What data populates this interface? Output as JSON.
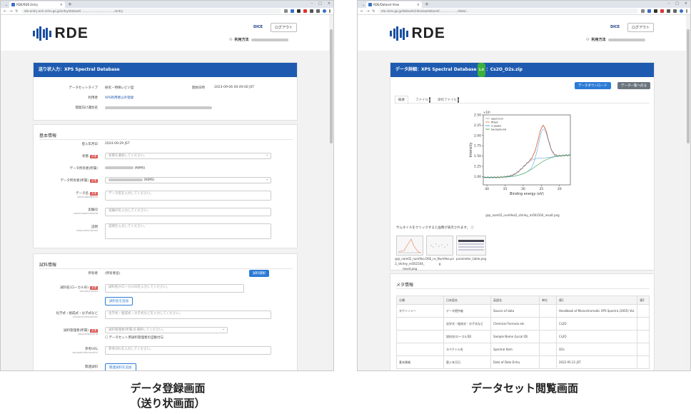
{
  "left": {
    "tab_title": "RDE/RDE Entry",
    "url": "rde-entry-arm.nims.go.jp/entry/dataset/...................................../entry",
    "logo_text": "RDE",
    "dice": "DICE",
    "logout": "ログアウト",
    "user_label": "利用方法",
    "band_title": "送り状入力：XPS Spectral Database",
    "info": {
      "dataset_type_label": "データセットタイプ",
      "dataset_type_value": "研究・特徴レビジ型",
      "registered_label": "開始日時",
      "registered_value": "2023-09-06 00:49:00 JST",
      "template_label": "利用者",
      "template_value": "XPS利用者以外登録",
      "dataset_id_label": "開発向け識別名"
    },
    "basic": {
      "title": "基本情報",
      "date_label": "登入年月日",
      "date_value": "2024-09-29 JST",
      "status_label": "状態",
      "status_placeholder": "状態を選択してください。",
      "owner_label": "データ所有者(所属)",
      "owner_suffix": "(NIMS)",
      "owner2_label": "データ所有者(所属)",
      "owner2_suffix": "(NIMS)",
      "dataname_label": "データ名",
      "dataname_sub": "basic/dataName",
      "dataname_placeholder": "データ名を入力してください。",
      "exp_label": "実験ID",
      "exp_sub": "basic/experimentId",
      "exp_placeholder": "実験IDを入力してください。",
      "desc_label": "説明",
      "desc_sub": "basic/description",
      "desc_placeholder": "説明を入力してください。",
      "required": "必須"
    },
    "sample": {
      "title": "試料情報",
      "owner_label": "所有者",
      "owner_value": "(所有者名)",
      "select_btn": "試料選択",
      "name_label": "試料名(ローカルID)",
      "name_sub": "sample/names",
      "name_placeholder": "試料名かローカルIDを入力してください。",
      "add_btn": "試料名を追加",
      "comp_label": "化学式・組成式・分子式など",
      "comp_sub": "sample/composition",
      "comp_placeholder": "化学式・組成式・分子式などを入力してください。",
      "manager_label": "試料管理者(所属)",
      "manager_sub": "sample/ownerId",
      "manager_placeholder": "試料管理者(所属)を選択してください。",
      "checkbox_text": "データセット用試料管理者の自動付与",
      "ref_label": "参考URL",
      "ref_sub": "sample/referenceUrl",
      "ref_placeholder": "参考URLを入力してください。",
      "tag_label": "関連試料",
      "tag_btn": "関連試料を追加"
    }
  },
  "right": {
    "tab_title": "RDE/Dataset View",
    "url": "rde.nims.go.jp/datasets/rdeview/dataset/..................../data/...",
    "band_prefix": "データ詳細：XPS Spectral Database",
    "band_version": "1.0",
    "band_suffix": "：Cs2O_O2s.zip",
    "download_btn": "データダウンロード",
    "list_btn": "データ一覧へ戻る",
    "tabs": [
      {
        "label": "概要",
        "badge": ""
      },
      {
        "label": "ファイル",
        "badge": "9"
      },
      {
        "label": "添付ファイル",
        "badge": "0"
      }
    ],
    "chart_caption": "gsp_nam02_num9ea2_shirley_mOS1504_result.png",
    "thumb_note": "サムネイルをクリックすると画像が表示されます。",
    "thumbs": [
      {
        "name": "gsp_nam02_num9ea2_shirley_mOS1504_result.png"
      },
      {
        "name": "DSE_ns_Num9ea.png"
      },
      {
        "name": "parameter_table.png"
      }
    ],
    "meta_title": "メタ情報",
    "meta_headers": [
      "分類",
      "日本語名",
      "英語名",
      "単位",
      "値1",
      "値2"
    ],
    "meta_rows": [
      [
        "タクソノミー",
        "データ提供者",
        "Source of data",
        "",
        "Handbook of Monochromatic XPS Spectra (2005) Vol.",
        ""
      ],
      [
        "",
        "化学式・組成式・分子式など",
        "Chemical Formula etc.",
        "",
        "Cs2O",
        ""
      ],
      [
        "",
        "試料名(ローカルID)",
        "Sample Name (Local ID)",
        "",
        "Cs2O",
        ""
      ],
      [
        "",
        "スペクトル名",
        "Spectral Item",
        "",
        "O2s",
        ""
      ],
      [
        "基本情報",
        "登入年月日",
        "Date of Data Entry",
        "",
        "2022-05-21 JST",
        ""
      ]
    ]
  },
  "chart_data": {
    "type": "line",
    "x_unit_label": "Binding energy (eV)",
    "ylabel": "Intensity",
    "y_multiplier": "×10⁴",
    "xlim": [
      41,
      17
    ],
    "ylim": [
      0.8,
      2.5
    ],
    "x_ticks": [
      40,
      35,
      30,
      25,
      20
    ],
    "y_ticks": [
      1.0,
      1.25,
      1.5,
      1.75,
      2.0,
      2.25,
      2.5
    ],
    "series": [
      {
        "name": "spectrum",
        "color": "#999999"
      },
      {
        "name": "fitted",
        "color": "#e8744a"
      },
      {
        "name": "2-peaks",
        "color": "#3a8ad6"
      },
      {
        "name": "background",
        "color": "#2e9e4a"
      }
    ]
  },
  "captions": {
    "left_line1": "データ登録画面",
    "left_line2": "（送り状画面）",
    "right_line1": "データセット閲覧画面"
  }
}
